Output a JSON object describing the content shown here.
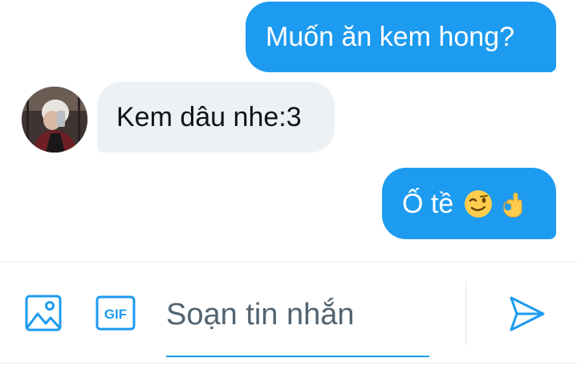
{
  "conversation": {
    "messages": [
      {
        "direction": "outgoing",
        "text": "Muốn ăn kem hong?",
        "emojis": []
      },
      {
        "direction": "incoming",
        "text": "Kem dâu nhe:3",
        "emojis": []
      },
      {
        "direction": "outgoing",
        "text": "Ố tề",
        "emojis": [
          "winking-face-emoji",
          "ok-hand-emoji"
        ]
      }
    ]
  },
  "composer": {
    "placeholder": "Soạn tin nhắn",
    "gif_label": "GIF",
    "icons": {
      "image": "image-icon",
      "gif": "gif-icon",
      "send": "send-icon"
    }
  },
  "colors": {
    "accent": "#1d9bf0",
    "incoming_bubble": "#eef1f4",
    "outgoing_text": "#ffffff",
    "incoming_text": "#0f1419"
  }
}
